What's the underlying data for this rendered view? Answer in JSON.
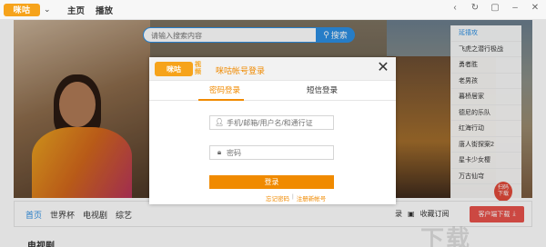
{
  "app": {
    "logo_text": "咪咕",
    "nav": [
      {
        "label": "主页"
      },
      {
        "label": "播放"
      }
    ],
    "window_controls": [
      "back-icon",
      "refresh-icon",
      "restore-icon",
      "minimize-icon",
      "close-icon"
    ]
  },
  "search": {
    "placeholder": "请输入搜索内容",
    "button_label": "搜索"
  },
  "rail": {
    "items": [
      {
        "label": "延禧攻"
      },
      {
        "label": "飞虎之潜行极战"
      },
      {
        "label": "勇者胜"
      },
      {
        "label": "老男孩"
      },
      {
        "label": "暮桥居家"
      },
      {
        "label": "德尼的乐队"
      },
      {
        "label": "红海行动"
      },
      {
        "label": "唐人街探案2"
      },
      {
        "label": "星卡少女樱"
      },
      {
        "label": "万古仙穹"
      }
    ]
  },
  "app_badge": {
    "line1": "扫码",
    "line2": "下载"
  },
  "navbar": {
    "links": [
      {
        "label": "首页"
      },
      {
        "label": "世界杯"
      },
      {
        "label": "电视剧"
      },
      {
        "label": "综艺"
      }
    ],
    "history_label": "录",
    "favorites_label": "收藏订阅",
    "client_button_label": "客户端下载"
  },
  "section": {
    "title": "电视剧"
  },
  "watermark": "下载",
  "modal": {
    "logo_text": "咪咕",
    "logo_sub_1": "视",
    "logo_sub_2": "频",
    "title": "咪咕帐号登录",
    "tabs": [
      {
        "label": "密码登录"
      },
      {
        "label": "短信登录"
      }
    ],
    "username_placeholder": "手机/邮箱/用户名/和通行证",
    "password_placeholder": "密码",
    "login_label": "登录",
    "forgot_label": "忘记密码",
    "separator": "|",
    "register_label": "注册新帐号"
  },
  "colors": {
    "accent_orange": "#f08a00",
    "accent_blue": "#2c8fe3",
    "badge_red": "#e24a3b"
  }
}
